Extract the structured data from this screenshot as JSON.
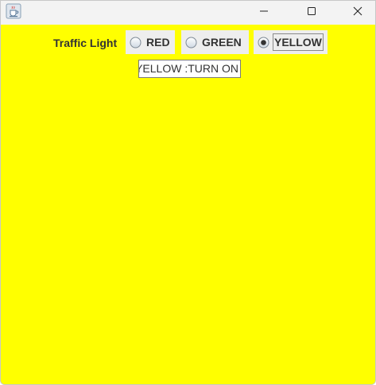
{
  "window": {
    "icon": "java-cup-icon",
    "controls": [
      "minimize-icon",
      "maximize-icon",
      "close-icon"
    ]
  },
  "form": {
    "label": "Traffic Light",
    "radios": [
      {
        "label": "RED",
        "selected": false
      },
      {
        "label": "GREEN",
        "selected": false
      },
      {
        "label": "YELLOW",
        "selected": true
      }
    ],
    "status_value": "YELLOW :TURN ON"
  },
  "colors": {
    "background": "#ffff00",
    "titlebar": "#f3f3f3",
    "radio_bg": "#eeeeee",
    "text": "#333333"
  }
}
